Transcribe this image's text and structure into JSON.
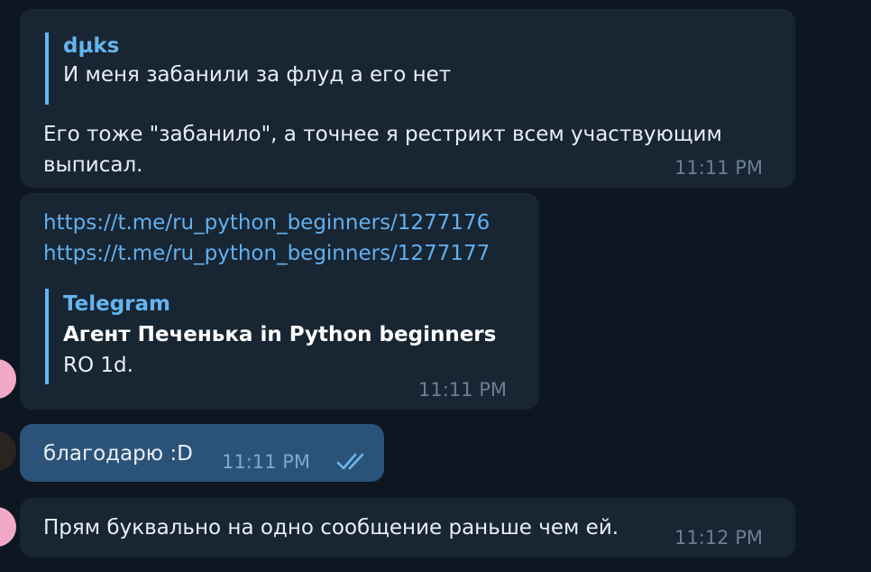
{
  "messages": [
    {
      "reply_author": "dµks",
      "reply_text": "И меня забанили за флуд а его нет",
      "text_line1": "Его тоже \"забанило\", а точнее я рестрикт всем участвующим",
      "text_line2": "выписал.",
      "time": "11:11 PM"
    },
    {
      "link1": "https://t.me/ru_python_beginners/1277176",
      "link2": "https://t.me/ru_python_beginners/1277177",
      "preview_site": "Telegram",
      "preview_title": "Агент Печенька in Python beginners",
      "preview_desc": "RO 1d.",
      "time": "11:11 PM"
    },
    {
      "text": "благодарю :D",
      "time": "11:11 PM",
      "status_icon": "double-check-icon"
    },
    {
      "text": "Прям буквально на одно сообщение раньше чем ей.",
      "time": "11:12 PM"
    }
  ],
  "colors": {
    "background": "#0e1621",
    "incoming_bubble": "#182533",
    "outgoing_bubble": "#2b5278",
    "accent": "#64b5ef",
    "link": "#62b0ee",
    "avatar_pink": "#f2a9c8",
    "avatar_dark": "#2a2420"
  }
}
